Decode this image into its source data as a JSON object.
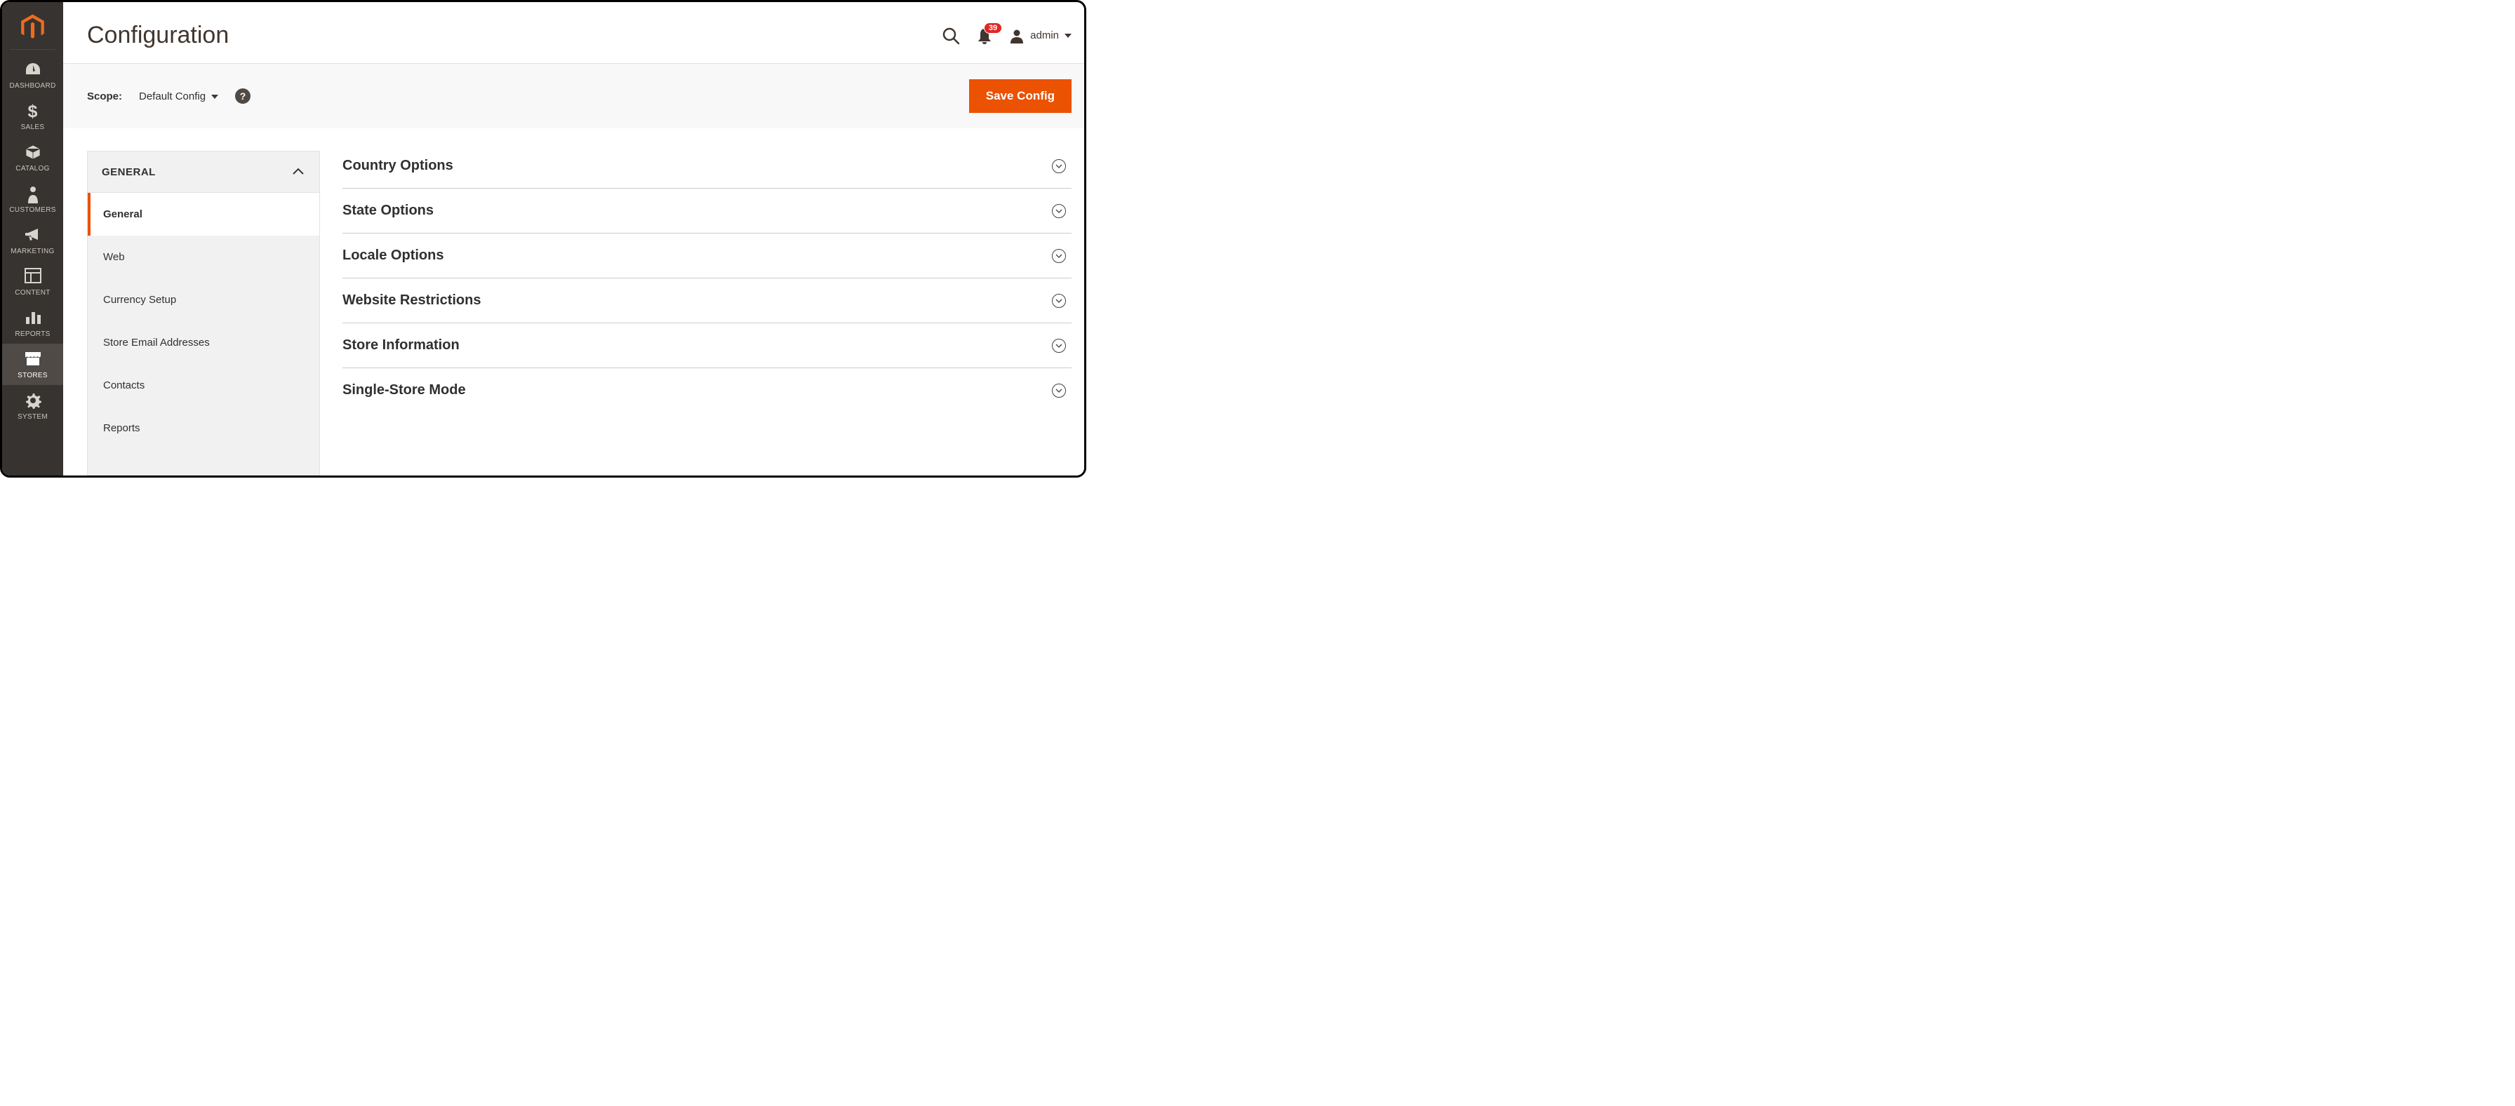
{
  "page": {
    "title": "Configuration"
  },
  "header": {
    "notification_count": "39",
    "user_name": "admin"
  },
  "scope": {
    "label": "Scope:",
    "value": "Default Config",
    "save_label": "Save Config"
  },
  "sidebar": {
    "items": [
      {
        "id": "dashboard",
        "label": "DASHBOARD"
      },
      {
        "id": "sales",
        "label": "SALES"
      },
      {
        "id": "catalog",
        "label": "CATALOG"
      },
      {
        "id": "customers",
        "label": "CUSTOMERS"
      },
      {
        "id": "marketing",
        "label": "MARKETING"
      },
      {
        "id": "content",
        "label": "CONTENT"
      },
      {
        "id": "reports",
        "label": "REPORTS"
      },
      {
        "id": "stores",
        "label": "STORES"
      },
      {
        "id": "system",
        "label": "SYSTEM"
      }
    ]
  },
  "config_nav": {
    "group_label": "GENERAL",
    "items": [
      {
        "label": "General",
        "active": true
      },
      {
        "label": "Web"
      },
      {
        "label": "Currency Setup"
      },
      {
        "label": "Store Email Addresses"
      },
      {
        "label": "Contacts"
      },
      {
        "label": "Reports"
      }
    ]
  },
  "sections": [
    {
      "title": "Country Options"
    },
    {
      "title": "State Options"
    },
    {
      "title": "Locale Options"
    },
    {
      "title": "Website Restrictions"
    },
    {
      "title": "Store Information"
    },
    {
      "title": "Single-Store Mode"
    }
  ]
}
